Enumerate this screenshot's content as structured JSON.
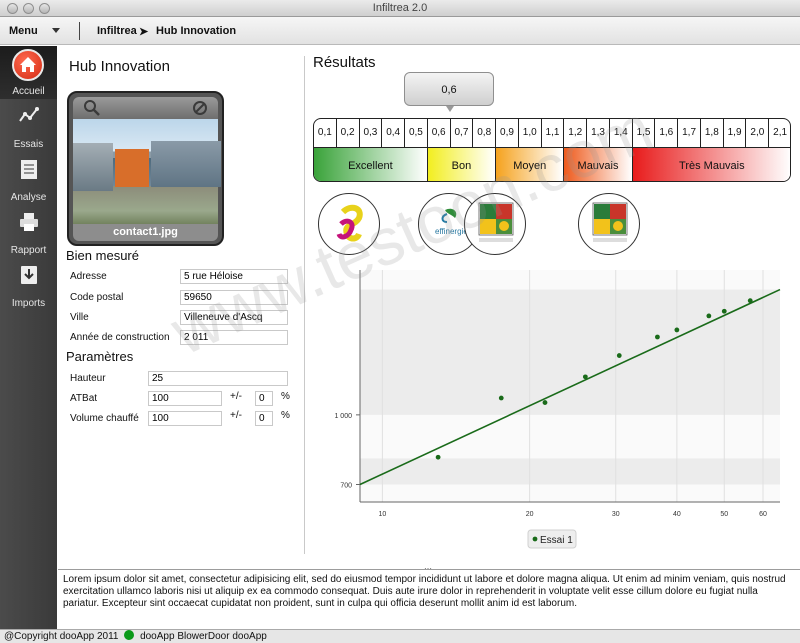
{
  "window": {
    "title": "Infiltrea 2.0"
  },
  "toolbar": {
    "menu_label": "Menu",
    "breadcrumb": [
      "Infiltrea",
      "Hub Innovation"
    ]
  },
  "sidebar": {
    "items": [
      {
        "label": "Accueil",
        "icon": "home-icon",
        "active": true
      },
      {
        "label": "Essais",
        "icon": "line-chart-icon"
      },
      {
        "label": "Analyse",
        "icon": "document-icon"
      },
      {
        "label": "Rapport",
        "icon": "printer-icon"
      },
      {
        "label": "Imports",
        "icon": "download-icon"
      }
    ]
  },
  "project": {
    "title": "Hub Innovation",
    "photo_caption": "contact1.jpg"
  },
  "bien": {
    "title": "Bien mesuré",
    "fields": [
      {
        "label": "Adresse",
        "value": "5 rue Héloise"
      },
      {
        "label": "Code postal",
        "value": "59650"
      },
      {
        "label": "Ville",
        "value": "Villeneuve d'Ascq"
      },
      {
        "label": "Année de construction",
        "value": "2 011"
      }
    ]
  },
  "parametres": {
    "title": "Paramètres",
    "hauteur": {
      "label": "Hauteur",
      "value": "25"
    },
    "atbat": {
      "label": "ATBat",
      "value": "100",
      "tol_label": "+/-",
      "tol_value": "0",
      "unit": "%"
    },
    "volume": {
      "label": "Volume chauffé",
      "value": "100",
      "tol_label": "+/-",
      "tol_value": "0",
      "unit": "%"
    }
  },
  "results": {
    "title": "Résultats",
    "value": "0,6",
    "scale_ticks": [
      "0,1",
      "0,2",
      "0,3",
      "0,4",
      "0,5",
      "0,6",
      "0,7",
      "0,8",
      "0,9",
      "1,0",
      "1,1",
      "1,2",
      "1,3",
      "1,4",
      "1,5",
      "1,6",
      "1,7",
      "1,8",
      "1,9",
      "2,0",
      "2,1"
    ],
    "bands": [
      {
        "label": "Excellent",
        "color": "#3aa33a"
      },
      {
        "label": "Bon",
        "color": "#f2ee1f"
      },
      {
        "label": "Moyen",
        "color": "#f5a21e"
      },
      {
        "label": "Mauvais",
        "color": "#ee5a1c"
      },
      {
        "label": "Très Mauvais",
        "color": "#e81c1c"
      }
    ]
  },
  "logos": [
    {
      "name": "effinergie-swirl-logo"
    },
    {
      "name": "effinergie-text-logo",
      "text": "effinergie"
    },
    {
      "name": "region-logo"
    },
    {
      "name": "region-logo"
    }
  ],
  "chart_data": {
    "type": "scatter",
    "x_scale": "log",
    "y_scale": "log",
    "x_ticks": [
      "10",
      "20",
      "30",
      "40",
      "50",
      "60"
    ],
    "y_ticks": [
      "700",
      "1 000"
    ],
    "xlim": [
      9,
      65
    ],
    "ylim": [
      640,
      2100
    ],
    "series": [
      {
        "name": "Essai 1",
        "color": "#1a6b1a",
        "points": [
          [
            13,
            805
          ],
          [
            17.5,
            1090
          ],
          [
            21.5,
            1065
          ],
          [
            26,
            1215
          ],
          [
            30.5,
            1355
          ],
          [
            36.5,
            1490
          ],
          [
            40,
            1545
          ],
          [
            46.5,
            1660
          ],
          [
            50,
            1700
          ],
          [
            56.5,
            1795
          ]
        ]
      }
    ],
    "fit_line": {
      "x": [
        9,
        65
      ],
      "y": [
        700,
        1900
      ],
      "color": "#1a6b1a"
    },
    "legend": {
      "entries": [
        "Essai 1"
      ],
      "position": "bottom-center"
    },
    "grid": true
  },
  "description": "Lorem ipsum dolor sit amet, consectetur adipisicing elit, sed do eiusmod tempor incididunt ut labore et dolore magna aliqua. Ut enim ad minim veniam, quis nostrud exercitation ullamco laboris nisi ut aliquip ex ea commodo consequat. Duis aute irure dolor in reprehenderit in voluptate velit esse cillum dolore eu fugiat nulla pariatur. Excepteur sint occaecat cupidatat non proident, sunt in culpa qui officia deserunt mollit anim id est laborum.",
  "footer": {
    "copyright": "@Copyright dooApp 2011",
    "status_text": "dooApp BlowerDoor dooApp"
  },
  "watermark": "www.testoon.com"
}
